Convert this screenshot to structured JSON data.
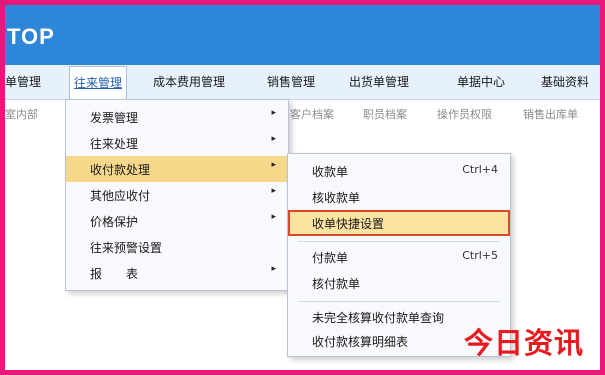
{
  "app": {
    "title": "TOP"
  },
  "menubar": {
    "items": [
      {
        "label": "单管理"
      },
      {
        "label": "往来管理"
      },
      {
        "label": "成本费用管理"
      },
      {
        "label": "销售管理"
      },
      {
        "label": "出货单管理"
      },
      {
        "label": "单据中心"
      },
      {
        "label": "基础资料"
      }
    ]
  },
  "toolbar": {
    "items": [
      {
        "label": "室内部"
      },
      {
        "label": "客户档案"
      },
      {
        "label": "职员档案"
      },
      {
        "label": "操作员权限"
      },
      {
        "label": "销售出库单"
      }
    ]
  },
  "menu1": {
    "items": [
      {
        "label": "发票管理",
        "submenu": true
      },
      {
        "label": "往来处理",
        "submenu": true
      },
      {
        "label": "收付款处理",
        "submenu": true
      },
      {
        "label": "其他应收付",
        "submenu": true
      },
      {
        "label": "价格保护",
        "submenu": true
      },
      {
        "label": "往来预警设置",
        "submenu": false
      },
      {
        "label": "报　　表",
        "submenu": true
      }
    ]
  },
  "menu2": {
    "items": [
      {
        "label": "收款单",
        "shortcut": "Ctrl+4"
      },
      {
        "label": "核收款单",
        "shortcut": ""
      },
      {
        "label": "收单快捷设置",
        "shortcut": ""
      },
      {
        "label": "付款单",
        "shortcut": "Ctrl+5"
      },
      {
        "label": "核付款单",
        "shortcut": ""
      },
      {
        "label": "未完全核算收付款单查询",
        "shortcut": ""
      },
      {
        "label": "收付款核算明细表",
        "shortcut": ""
      }
    ]
  },
  "watermark": {
    "text": "今日资讯"
  },
  "colors": {
    "frame": "#e8177a",
    "titlebar": "#2d86d8",
    "highlight": "#f6d88a",
    "callout_border": "#d84a2a",
    "watermark": "#e8191f"
  }
}
